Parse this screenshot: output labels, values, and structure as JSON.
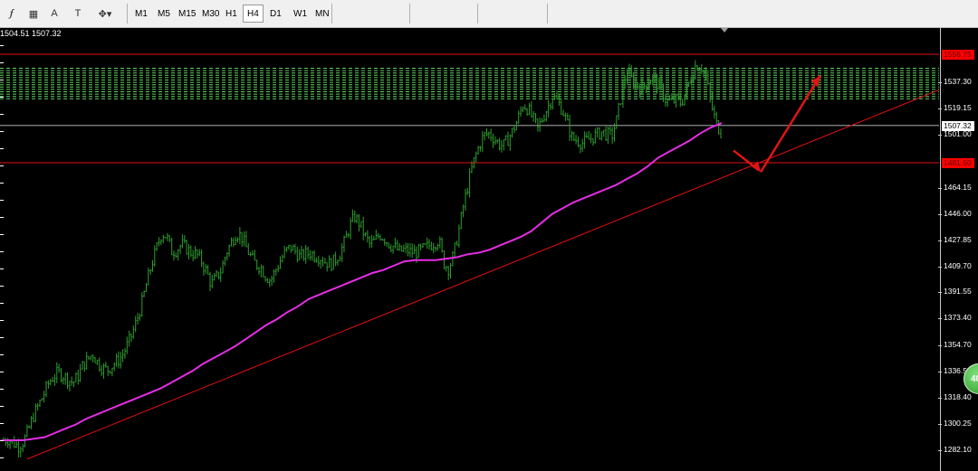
{
  "toolbar": {
    "tools": [
      {
        "name": "indicators-icon",
        "glyph": "𝆑"
      },
      {
        "name": "grid-icon",
        "glyph": "▦"
      },
      {
        "name": "text-tool-icon",
        "glyph": "A"
      },
      {
        "name": "text-label-icon",
        "glyph": "T"
      },
      {
        "name": "shapes-icon",
        "glyph": "✥▾"
      }
    ],
    "periods": [
      "M1",
      "M5",
      "M15",
      "M30",
      "H1",
      "H4",
      "D1",
      "W1",
      "MN"
    ],
    "active_period": "H4"
  },
  "chart_info": "1504.51 1507.32",
  "price_axis": {
    "ticks": [
      "1537.30",
      "1519.15",
      "1501.00",
      "1464.15",
      "1446.00",
      "1427.85",
      "1409.70",
      "1391.55",
      "1373.40",
      "1354.70",
      "1336.55",
      "1318.40",
      "1300.25",
      "1282.10"
    ],
    "labels": [
      {
        "text": "1556.75",
        "style": "red"
      },
      {
        "text": "1507.32",
        "style": "white"
      },
      {
        "text": "1481.50",
        "style": "red"
      }
    ]
  },
  "badge_text": "40",
  "colors": {
    "candles": "#2f9e2f",
    "moving_average": "#e52ee5",
    "resistance": "#e01010",
    "trendline": "#e01010",
    "arrows": "#e01414",
    "zone_dashes": "#5fd35f",
    "current_price_line": "#c8c8c8"
  },
  "chart_data": {
    "type": "candlestick",
    "x_axis_labels": [],
    "y_ticks": [
      1537.3,
      1519.15,
      1501.0,
      1464.15,
      1446.0,
      1427.85,
      1409.7,
      1391.55,
      1373.4,
      1354.7,
      1336.55,
      1318.4,
      1300.25,
      1282.1
    ],
    "ylim": [
      1276,
      1566
    ],
    "current_price": 1507.32,
    "horizontal_levels": [
      1556.75,
      1481.5
    ],
    "dashed_zone": [
      1525,
      1547
    ],
    "close_path": [
      1289,
      1290,
      1287,
      1285,
      1288,
      1296,
      1306,
      1313,
      1320,
      1328,
      1333,
      1336,
      1334,
      1331,
      1329,
      1333,
      1341,
      1345,
      1349,
      1343,
      1339,
      1338,
      1341,
      1344,
      1348,
      1355,
      1363,
      1373,
      1385,
      1399,
      1412,
      1423,
      1433,
      1430,
      1420,
      1421,
      1425,
      1422,
      1419,
      1418,
      1413,
      1406,
      1397,
      1402,
      1407,
      1419,
      1426,
      1433,
      1431,
      1423,
      1416,
      1411,
      1409,
      1403,
      1400,
      1407,
      1414,
      1420,
      1423,
      1420,
      1416,
      1418,
      1419,
      1417,
      1416,
      1413,
      1411,
      1414,
      1419,
      1427,
      1438,
      1444,
      1439,
      1431,
      1425,
      1427,
      1432,
      1429,
      1425,
      1423,
      1420,
      1421,
      1420,
      1419,
      1420,
      1422,
      1424,
      1426,
      1428,
      1412,
      1408,
      1418,
      1434,
      1452,
      1468,
      1482,
      1492,
      1500,
      1502,
      1499,
      1495,
      1493,
      1498,
      1504,
      1512,
      1522,
      1519,
      1512,
      1505,
      1513,
      1520,
      1528,
      1524,
      1518,
      1508,
      1498,
      1497,
      1495,
      1497,
      1499,
      1501,
      1503,
      1501,
      1500,
      1512,
      1530,
      1546,
      1539,
      1536,
      1533,
      1537,
      1541,
      1537,
      1532,
      1524,
      1524,
      1525,
      1523,
      1531,
      1541,
      1550,
      1549,
      1541,
      1523,
      1509,
      1503
    ],
    "moving_average": [
      1289,
      1289,
      1289,
      1290,
      1291,
      1294,
      1297,
      1300,
      1304,
      1307,
      1310,
      1313,
      1316,
      1319,
      1322,
      1325,
      1329,
      1333,
      1337,
      1342,
      1346,
      1350,
      1354,
      1359,
      1364,
      1369,
      1373,
      1378,
      1382,
      1387,
      1390,
      1393,
      1396,
      1399,
      1402,
      1405,
      1407,
      1410,
      1413,
      1414,
      1414,
      1414,
      1415,
      1416,
      1418,
      1419,
      1421,
      1424,
      1427,
      1430,
      1434,
      1440,
      1446,
      1450,
      1454,
      1457,
      1460,
      1463,
      1466,
      1470,
      1474,
      1479,
      1485,
      1489,
      1493,
      1497,
      1502,
      1506,
      1509
    ],
    "trendline_start": 1276,
    "trendline_end": 1532,
    "projection_arrows": [
      {
        "from": 1490,
        "to": 1475
      },
      {
        "from": 1475,
        "to": 1542
      }
    ]
  }
}
